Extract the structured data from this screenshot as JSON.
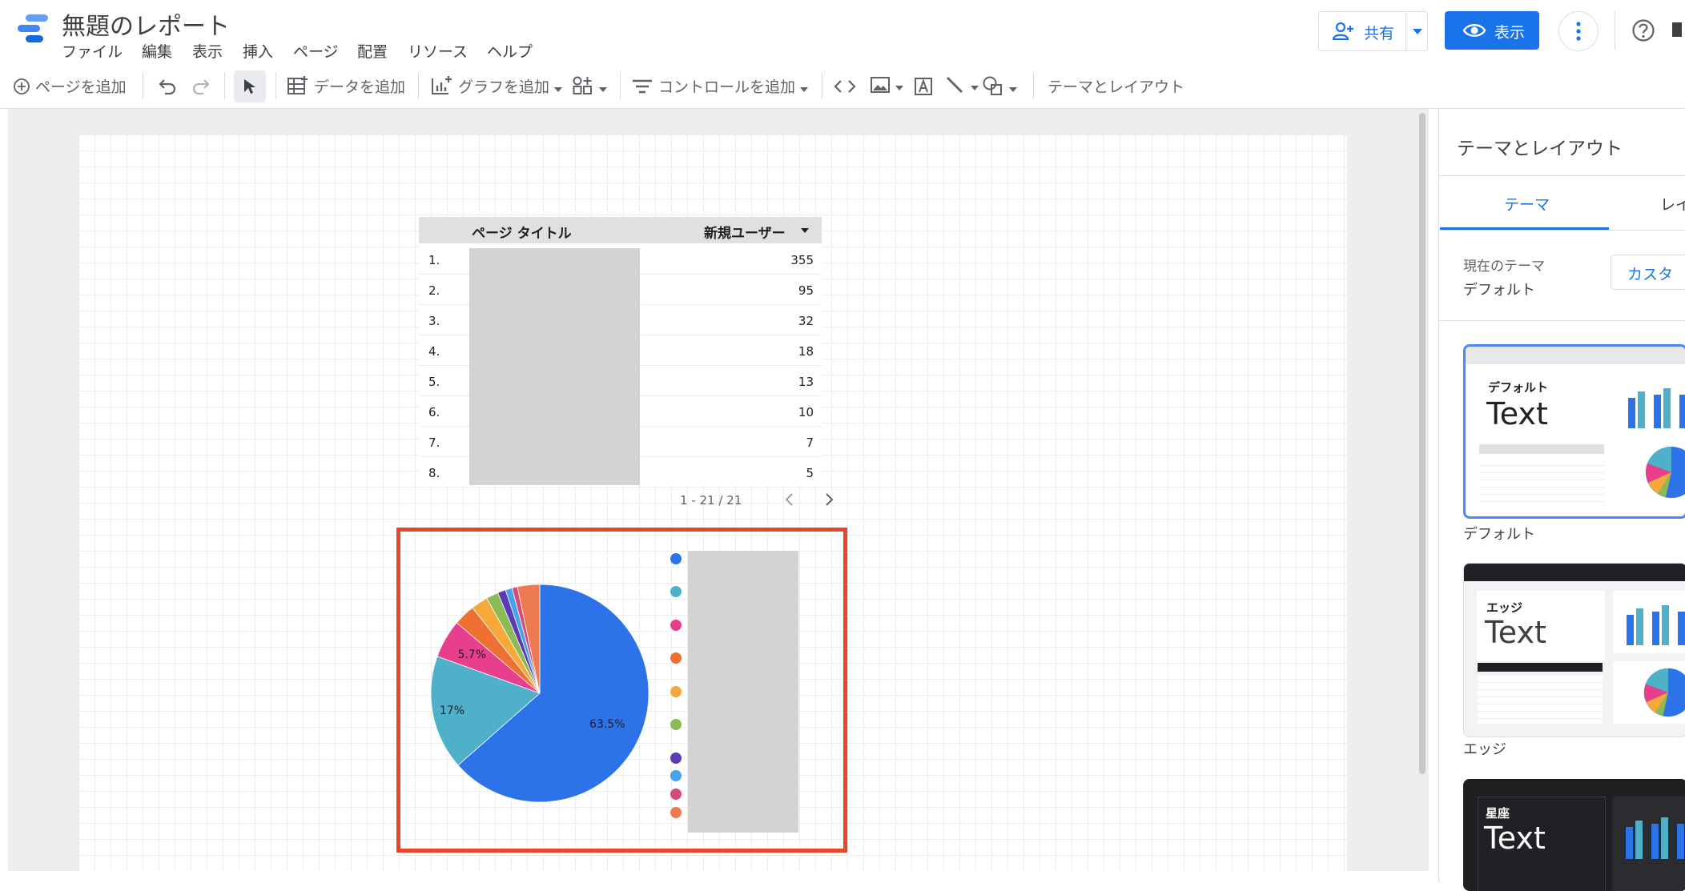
{
  "header": {
    "title": "無題のレポート",
    "menu": [
      "ファイル",
      "編集",
      "表示",
      "挿入",
      "ページ",
      "配置",
      "リソース",
      "ヘルプ"
    ],
    "share_label": "共有",
    "view_label": "表示"
  },
  "toolbar": {
    "add_page": "ページを追加",
    "add_data": "データを追加",
    "add_chart": "グラフを追加",
    "add_control": "コントロールを追加",
    "theme_layout": "テーマとレイアウト"
  },
  "table": {
    "columns": [
      "ページ タイトル",
      "新規ユーザー"
    ],
    "rows": [
      {
        "index": "1.",
        "value": "355"
      },
      {
        "index": "2.",
        "value": "95"
      },
      {
        "index": "3.",
        "value": "32"
      },
      {
        "index": "4.",
        "value": "18"
      },
      {
        "index": "5.",
        "value": "13"
      },
      {
        "index": "6.",
        "value": "10"
      },
      {
        "index": "7.",
        "value": "7"
      },
      {
        "index": "8.",
        "value": "5"
      }
    ],
    "pagination": "1 - 21 / 21"
  },
  "chart_data": {
    "type": "pie",
    "values": [
      63.5,
      17,
      5.7,
      3.2,
      2.5,
      1.8,
      1.2,
      1,
      0.8,
      3.3
    ],
    "data_labels": [
      "63.5%",
      "17%",
      "5.7%"
    ],
    "colors": [
      "#2c72e8",
      "#4eb1c9",
      "#e83f8d",
      "#ee7032",
      "#f4a93a",
      "#8cba54",
      "#5a3bb5",
      "#47a1ee",
      "#d94b76",
      "#ee7a52"
    ]
  },
  "panel": {
    "title": "テーマとレイアウト",
    "tab_theme": "テーマ",
    "tab_layout": "レイ",
    "current_theme_label": "現在のテーマ",
    "current_theme_value": "デフォルト",
    "customize_label": "カスタ",
    "themes": [
      {
        "small": "デフォルト",
        "sample": "Text",
        "name": "デフォルト"
      },
      {
        "small": "エッジ",
        "sample": "Text",
        "name": "エッジ"
      },
      {
        "small": "星座",
        "sample": "Text"
      }
    ]
  },
  "colors": {
    "accent": "#1a73e8",
    "highlight_frame": "#e8452c"
  }
}
